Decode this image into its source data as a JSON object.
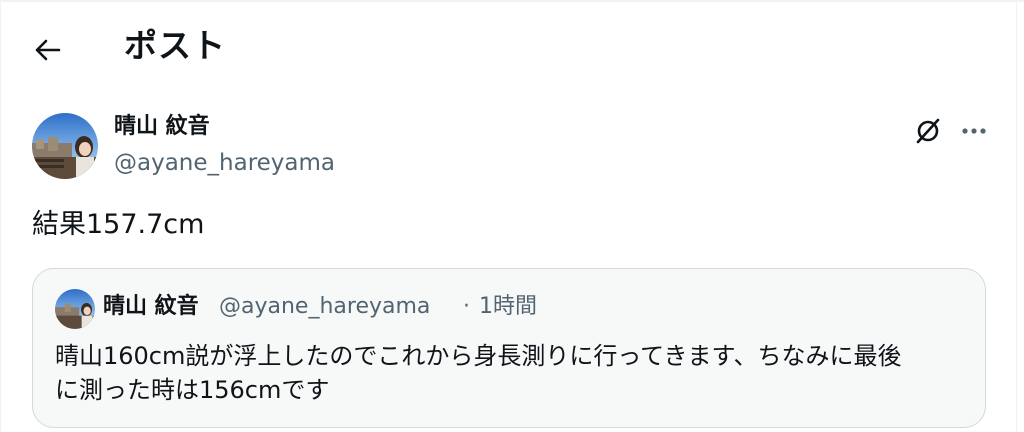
{
  "header": {
    "title": "ポスト",
    "back_icon": "arrow-left-icon"
  },
  "post": {
    "author": {
      "display_name": "晴山 紋音",
      "handle": "@ayane_hareyama",
      "avatar": "avatar-photo"
    },
    "actions": {
      "grok_icon": "grok-icon",
      "more_icon": "more-icon"
    },
    "text": "結果157.7cm"
  },
  "quoted_post": {
    "author": {
      "display_name": "晴山 紋音",
      "handle": "@ayane_hareyama",
      "avatar": "avatar-photo"
    },
    "separator": "·",
    "time": "1時間",
    "text_line1": "晴山160cm説が浮上したのでこれから身長測りに行ってきます、ちなみに最後",
    "text_line2": "に測った時は156cmです"
  },
  "colors": {
    "text_primary": "#0f1419",
    "text_secondary": "#536471",
    "border": "#cfd9de",
    "quote_bg": "#f7f9f9"
  }
}
